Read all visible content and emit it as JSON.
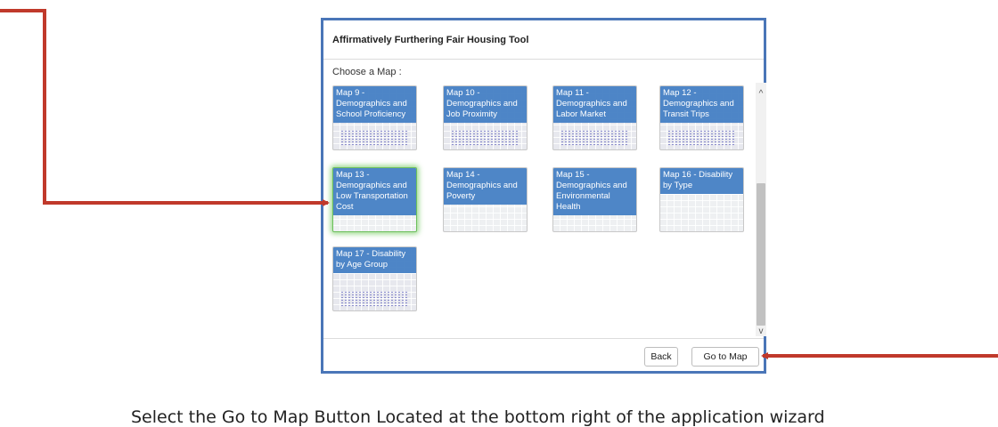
{
  "dialog": {
    "title": "Affirmatively Furthering Fair Housing Tool",
    "choose_label": "Choose a Map :",
    "maps": [
      {
        "label": "Map 9 - Demographics and School Proficiency",
        "selected": false
      },
      {
        "label": "Map 10 - Demographics and Job Proximity",
        "selected": false
      },
      {
        "label": "Map 11 - Demographics and Labor Market",
        "selected": false
      },
      {
        "label": "Map 12 - Demographics and Transit Trips",
        "selected": false
      },
      {
        "label": "Map 13 - Demographics and Low Transportation Cost",
        "selected": true
      },
      {
        "label": "Map 14 - Demographics and Poverty",
        "selected": false
      },
      {
        "label": "Map 15 - Demographics and Environmental Health",
        "selected": false
      },
      {
        "label": "Map 16 - Disability by Type",
        "selected": false
      },
      {
        "label": "Map 17 - Disability by Age Group",
        "selected": false
      }
    ],
    "buttons": {
      "back": "Back",
      "go_to_map": "Go to Map"
    },
    "scroll_up_glyph": "^",
    "scroll_down_glyph": "v"
  },
  "instruction": "Select the Go to Map Button Located at the bottom right of the application wizard",
  "colors": {
    "tile_label_bg": "#4580c4",
    "dialog_border": "#4a76b8",
    "arrow": "#c0392b",
    "selected_glow": "#6ec85a"
  }
}
